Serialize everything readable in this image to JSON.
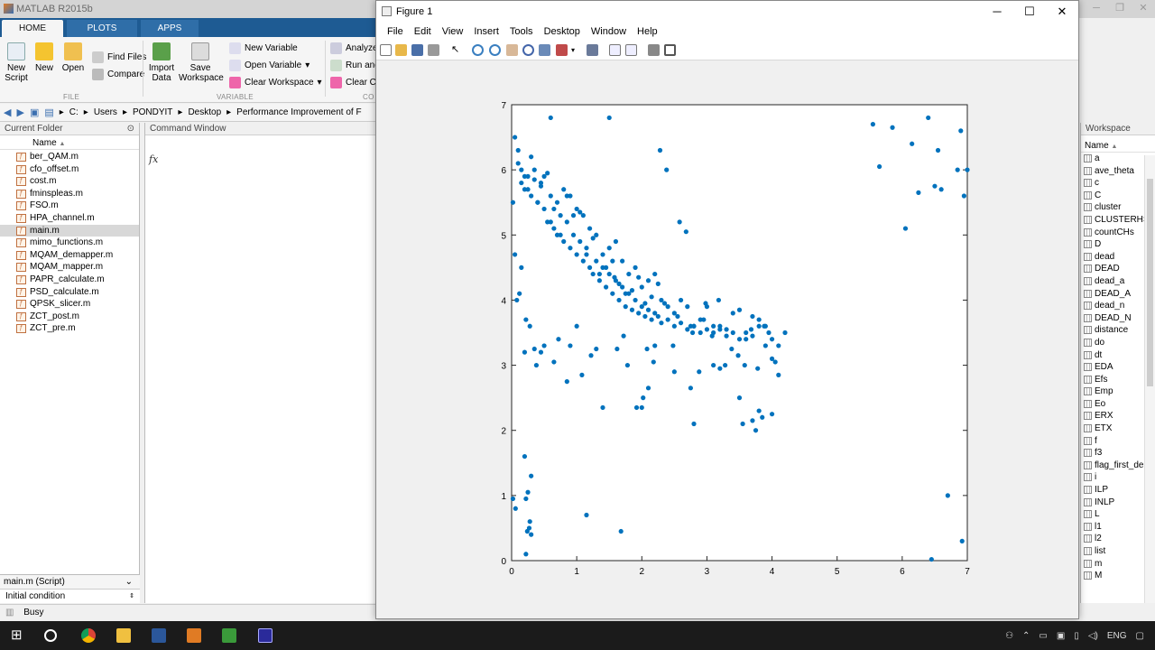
{
  "matlab": {
    "title": "MATLAB R2015b",
    "tabs": [
      "HOME",
      "PLOTS",
      "APPS"
    ],
    "ribbon": {
      "new_script": "New\nScript",
      "new": "New",
      "open": "Open",
      "find_files": "Find Files",
      "compare": "Compare",
      "import_data": "Import\nData",
      "save_workspace": "Save\nWorkspace",
      "new_variable": "New Variable",
      "open_variable": "Open Variable",
      "clear_workspace": "Clear Workspace",
      "analyze": "Analyze",
      "run_and": "Run and",
      "clear_co": "Clear Co",
      "sections": {
        "file": "FILE",
        "variable": "VARIABLE",
        "code": "CO"
      }
    },
    "address": [
      "C:",
      "Users",
      "PONDYIT",
      "Desktop",
      "Performance Improvement of F"
    ],
    "current_folder": {
      "title": "Current Folder",
      "column": "Name",
      "files": [
        "ber_QAM.m",
        "cfo_offset.m",
        "cost.m",
        "fminspleas.m",
        "FSO.m",
        "HPA_channel.m",
        "main.m",
        "mimo_functions.m",
        "MQAM_demapper.m",
        "MQAM_mapper.m",
        "PAPR_calculate.m",
        "PSD_calculate.m",
        "QPSK_slicer.m",
        "ZCT_post.m",
        "ZCT_pre.m"
      ],
      "selected": "main.m",
      "details_file": "main.m  (Script)",
      "details_text": "Initial condition"
    },
    "command_window": {
      "title": "Command Window",
      "prompt": "fx"
    },
    "workspace": {
      "title": "Workspace",
      "column": "Name",
      "vars": [
        "a",
        "ave_theta",
        "c",
        "C",
        "cluster",
        "CLUSTERHS",
        "countCHs",
        "D",
        "dead",
        "DEAD",
        "dead_a",
        "DEAD_A",
        "dead_n",
        "DEAD_N",
        "distance",
        "do",
        "dt",
        "EDA",
        "Efs",
        "Emp",
        "Eo",
        "ERX",
        "ETX",
        "f",
        "f3",
        "flag_first_de",
        "i",
        "ILP",
        "INLP",
        "L",
        "l1",
        "l2",
        "list",
        "m",
        "M"
      ]
    },
    "status": "Busy"
  },
  "figure": {
    "title": "Figure 1",
    "menu": [
      "File",
      "Edit",
      "View",
      "Insert",
      "Tools",
      "Desktop",
      "Window",
      "Help"
    ]
  },
  "chart_data": {
    "type": "scatter",
    "xlim": [
      0,
      7
    ],
    "ylim": [
      0,
      7
    ],
    "xticks": [
      "0",
      "1",
      "2",
      "3",
      "4",
      "5",
      "6",
      "7"
    ],
    "yticks": [
      "0",
      "1",
      "2",
      "3",
      "4",
      "5",
      "6",
      "7"
    ],
    "color": "#0072bd",
    "x": [
      0.05,
      0.1,
      0.15,
      0.2,
      0.25,
      0.3,
      0.35,
      0.4,
      0.45,
      0.5,
      0.55,
      0.6,
      0.65,
      0.7,
      0.75,
      0.8,
      0.85,
      0.9,
      0.95,
      1.0,
      1.05,
      1.1,
      1.15,
      1.2,
      1.25,
      1.3,
      1.35,
      1.4,
      1.45,
      1.5,
      1.55,
      1.6,
      1.65,
      1.7,
      1.75,
      1.8,
      1.85,
      1.9,
      1.95,
      2.0,
      2.05,
      2.1,
      2.15,
      2.2,
      2.25,
      2.3,
      2.4,
      2.5,
      2.6,
      2.7,
      2.8,
      2.9,
      3.0,
      3.1,
      3.2,
      3.3,
      3.4,
      3.5,
      3.6,
      3.7,
      3.8,
      3.9,
      4.0,
      4.1,
      4.2,
      0.1,
      0.3,
      0.5,
      0.7,
      0.9,
      1.1,
      1.3,
      1.5,
      1.7,
      1.9,
      2.1,
      2.3,
      2.5,
      2.7,
      2.9,
      3.1,
      3.3,
      3.5,
      3.7,
      3.9,
      0.2,
      0.4,
      0.6,
      0.8,
      1.0,
      1.2,
      1.4,
      1.6,
      1.8,
      2.0,
      2.2,
      2.4,
      2.6,
      2.8,
      3.0,
      3.2,
      3.4,
      3.6,
      3.8,
      0.15,
      0.35,
      0.55,
      0.75,
      0.95,
      1.15,
      1.35,
      1.55,
      1.75,
      1.95,
      2.15,
      2.35,
      2.55,
      2.75,
      2.95,
      0.25,
      0.45,
      0.65,
      0.85,
      1.05,
      1.25,
      1.45,
      1.65,
      1.85,
      2.05,
      2.25,
      0.2,
      0.3,
      0.25,
      0.22,
      0.28,
      0.02,
      0.06,
      0.24,
      0.3,
      0.22,
      0.27,
      1.15,
      1.68,
      0.85,
      1.4,
      2.0,
      2.1,
      2.8,
      3.5,
      3.55,
      3.8,
      3.85,
      4.0,
      2.75,
      3.2,
      3.7,
      3.75,
      2.5,
      3.1,
      2.2,
      4.0,
      4.05,
      4.1,
      3.95,
      0.9,
      1.3,
      5.55,
      5.65,
      5.85,
      6.15,
      6.4,
      6.5,
      6.6,
      6.85,
      6.9,
      7.0,
      6.95,
      6.25,
      6.7,
      6.55,
      6.05,
      6.45,
      6.92,
      0.02,
      0.05,
      0.12,
      0.2,
      0.28,
      0.35,
      0.22,
      0.45,
      0.6,
      0.08,
      0.15,
      0.38,
      0.5,
      0.65,
      0.72,
      1.0,
      1.08,
      1.22,
      1.5,
      1.58,
      1.62,
      1.72,
      1.78,
      1.92,
      2.02,
      2.08,
      2.18,
      2.28,
      2.38,
      2.48,
      2.58,
      2.68,
      2.78,
      2.88,
      2.98,
      3.08,
      3.18,
      3.28,
      3.38,
      3.48,
      3.58,
      3.68,
      3.78,
      3.88
    ],
    "y": [
      6.5,
      6.3,
      5.8,
      5.9,
      5.7,
      5.6,
      6.0,
      5.5,
      5.8,
      5.4,
      5.2,
      5.6,
      5.1,
      5.0,
      5.3,
      4.9,
      5.2,
      4.8,
      5.0,
      4.7,
      4.9,
      4.6,
      4.8,
      4.5,
      4.4,
      4.6,
      4.3,
      4.5,
      4.2,
      4.4,
      4.1,
      4.3,
      4.0,
      4.2,
      3.9,
      4.1,
      3.85,
      4.0,
      3.8,
      3.9,
      3.75,
      3.85,
      3.7,
      3.8,
      3.75,
      3.65,
      3.7,
      3.6,
      3.65,
      3.55,
      3.6,
      3.5,
      3.55,
      3.5,
      3.6,
      3.45,
      3.5,
      3.4,
      3.5,
      3.45,
      3.7,
      3.6,
      3.4,
      3.3,
      3.5,
      6.1,
      6.2,
      5.9,
      5.5,
      5.6,
      5.3,
      5.0,
      4.8,
      4.6,
      4.5,
      4.3,
      4.0,
      3.8,
      3.9,
      3.7,
      3.6,
      3.55,
      3.85,
      3.75,
      3.3,
      5.7,
      5.5,
      5.2,
      5.7,
      5.4,
      5.1,
      4.7,
      4.9,
      4.4,
      4.2,
      4.4,
      3.9,
      4.0,
      3.6,
      3.9,
      3.55,
      3.8,
      3.4,
      3.6,
      6.0,
      5.85,
      5.95,
      5.0,
      5.3,
      4.7,
      4.4,
      4.6,
      4.1,
      4.35,
      4.05,
      3.95,
      3.75,
      3.6,
      3.7,
      5.9,
      5.75,
      5.4,
      5.6,
      5.35,
      4.95,
      4.5,
      4.25,
      4.15,
      3.95,
      4.25,
      1.6,
      1.3,
      1.05,
      0.95,
      0.6,
      0.95,
      0.8,
      0.45,
      0.4,
      0.1,
      0.5,
      0.7,
      0.45,
      2.75,
      2.35,
      2.35,
      2.65,
      2.1,
      2.5,
      2.1,
      2.3,
      2.2,
      2.25,
      2.65,
      2.95,
      2.15,
      2.0,
      2.9,
      3.0,
      3.3,
      3.1,
      3.05,
      2.85,
      3.5,
      3.3,
      3.25,
      6.7,
      6.05,
      6.65,
      6.4,
      6.8,
      5.75,
      5.7,
      6.0,
      6.6,
      6.0,
      5.6,
      5.65,
      1.0,
      6.3,
      5.1,
      0.02,
      0.3,
      5.5,
      4.7,
      4.1,
      3.2,
      3.6,
      3.25,
      3.7,
      3.2,
      6.8,
      4.0,
      4.5,
      3.0,
      3.3,
      3.05,
      3.4,
      3.6,
      2.85,
      3.15,
      6.8,
      4.35,
      3.25,
      3.45,
      3.0,
      2.35,
      2.5,
      3.25,
      3.05,
      6.3,
      6.0,
      3.3,
      5.2,
      5.05,
      3.5,
      2.9,
      3.95,
      3.45,
      4.0,
      3.0,
      3.25,
      3.15,
      3.0,
      3.55,
      2.95,
      3.6,
      2.85,
      2.75
    ]
  }
}
